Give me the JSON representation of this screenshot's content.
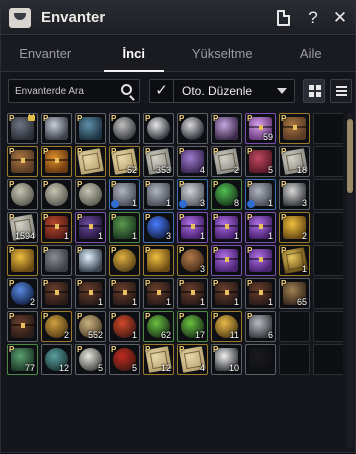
{
  "window": {
    "title": "Envanter",
    "icon": "storage-icon",
    "buttons": [
      {
        "name": "memo-icon",
        "glyph": ""
      },
      {
        "name": "help-icon",
        "glyph": "?"
      },
      {
        "name": "close-icon",
        "glyph": "✕"
      }
    ]
  },
  "tabs": [
    {
      "label": "Envanter",
      "active": false
    },
    {
      "label": "İnci",
      "active": true
    },
    {
      "label": "Yükseltme",
      "active": false
    },
    {
      "label": "Aile",
      "active": false
    }
  ],
  "toolbar": {
    "search_placeholder": "Envanterde Ara",
    "auto_sort_checked": true,
    "sort_label": "Oto. Düzenle"
  },
  "colors": {
    "accent_gold": "#9c7c2a",
    "rarity_purple": "#7b4fb3",
    "rarity_blue": "#3c6fb5",
    "rarity_green": "#4c8a46",
    "background": "#14161b"
  },
  "slots": [
    {
      "kind": "skin-dark",
      "p": true,
      "locked": true,
      "qty": "",
      "rarity": "gray"
    },
    {
      "kind": "wing-silver",
      "p": true,
      "qty": "",
      "rarity": "gray"
    },
    {
      "kind": "armor-blue",
      "p": true,
      "qty": "",
      "rarity": "gray"
    },
    {
      "kind": "flower-gray",
      "p": true,
      "qty": "",
      "rarity": "gray"
    },
    {
      "kind": "star-moon",
      "p": true,
      "qty": "",
      "rarity": "gray"
    },
    {
      "kind": "crescent",
      "p": true,
      "qty": "",
      "rarity": "gray"
    },
    {
      "kind": "pearl-box",
      "p": true,
      "qty": "",
      "rarity": "gray"
    },
    {
      "kind": "gift-box",
      "p": true,
      "qty": "59",
      "rarity": "purple"
    },
    {
      "kind": "chest-brown",
      "p": true,
      "qty": "",
      "rarity": "gold"
    },
    {
      "kind": "empty",
      "p": false,
      "qty": "",
      "rarity": ""
    },
    {
      "kind": "chest-brown",
      "p": true,
      "qty": "",
      "rarity": "gold"
    },
    {
      "kind": "chest-orange",
      "p": true,
      "qty": "",
      "rarity": "gold"
    },
    {
      "kind": "scroll-tan",
      "p": true,
      "qty": "",
      "rarity": "gold"
    },
    {
      "kind": "scroll-tan",
      "p": true,
      "qty": "52",
      "rarity": "gold"
    },
    {
      "kind": "scroll-gray",
      "p": true,
      "qty": "353",
      "rarity": "gray"
    },
    {
      "kind": "potion-purple",
      "p": true,
      "qty": "4",
      "rarity": "gray"
    },
    {
      "kind": "scroll-gray",
      "p": true,
      "qty": "2",
      "rarity": "gray"
    },
    {
      "kind": "book-red",
      "p": true,
      "qty": "5",
      "rarity": "gray"
    },
    {
      "kind": "scroll-gray",
      "p": true,
      "qty": "18",
      "rarity": "gray"
    },
    {
      "kind": "empty",
      "p": false,
      "qty": "",
      "rarity": ""
    },
    {
      "kind": "helm-gray",
      "p": true,
      "qty": "",
      "rarity": "gray"
    },
    {
      "kind": "helm-gray",
      "p": true,
      "qty": "",
      "rarity": "gray"
    },
    {
      "kind": "helm-gray",
      "p": true,
      "qty": "",
      "rarity": "gray"
    },
    {
      "kind": "stone-gray",
      "p": true,
      "qty": "1",
      "enh": true,
      "rarity": "blue"
    },
    {
      "kind": "stone-gray",
      "p": true,
      "qty": "1",
      "rarity": "gray"
    },
    {
      "kind": "horn-gray",
      "p": true,
      "qty": "3",
      "enh": true,
      "rarity": "blue"
    },
    {
      "kind": "orb-green",
      "p": true,
      "qty": "8",
      "rarity": "green"
    },
    {
      "kind": "stone-gray",
      "p": true,
      "qty": "1",
      "enh": true,
      "rarity": "blue"
    },
    {
      "kind": "tree-silver",
      "p": true,
      "qty": "3",
      "rarity": "gray"
    },
    {
      "kind": "empty",
      "p": false,
      "qty": "",
      "rarity": ""
    },
    {
      "kind": "scroll-gray",
      "p": true,
      "qty": "1594",
      "rarity": "gray"
    },
    {
      "kind": "chest-red",
      "p": true,
      "qty": "1",
      "rarity": "gold"
    },
    {
      "kind": "box-purple",
      "p": true,
      "qty": "1",
      "rarity": "purple"
    },
    {
      "kind": "book-green",
      "p": true,
      "qty": "1",
      "rarity": "green"
    },
    {
      "kind": "orb-blue",
      "p": true,
      "qty": "3",
      "rarity": "blue"
    },
    {
      "kind": "chest-purple",
      "p": true,
      "qty": "1",
      "rarity": "purple"
    },
    {
      "kind": "chest-purple",
      "p": true,
      "qty": "1",
      "rarity": "purple"
    },
    {
      "kind": "chest-purple",
      "p": true,
      "qty": "1",
      "rarity": "purple"
    },
    {
      "kind": "horn-gold",
      "p": true,
      "qty": "2",
      "rarity": "gold"
    },
    {
      "kind": "empty",
      "p": false,
      "qty": "",
      "rarity": ""
    },
    {
      "kind": "horn-gold",
      "p": true,
      "qty": "",
      "rarity": "gold"
    },
    {
      "kind": "pattern-gray",
      "p": true,
      "qty": "",
      "rarity": "gray"
    },
    {
      "kind": "crystal-white",
      "p": true,
      "qty": "",
      "rarity": "gray"
    },
    {
      "kind": "ring-gold",
      "p": true,
      "qty": "",
      "rarity": "gold"
    },
    {
      "kind": "horn-gold",
      "p": true,
      "qty": "",
      "rarity": "gold"
    },
    {
      "kind": "cookie-brown",
      "p": true,
      "qty": "3",
      "rarity": "gold"
    },
    {
      "kind": "chest-purple",
      "p": true,
      "qty": "",
      "rarity": "purple"
    },
    {
      "kind": "chest-purple",
      "p": true,
      "qty": "",
      "rarity": "purple"
    },
    {
      "kind": "ticket-gold",
      "p": true,
      "qty": "1",
      "rarity": "gold"
    },
    {
      "kind": "empty",
      "p": false,
      "qty": "",
      "rarity": ""
    },
    {
      "kind": "potion-blue",
      "p": true,
      "qty": "2",
      "rarity": "gray"
    },
    {
      "kind": "chest-dark",
      "p": true,
      "qty": "",
      "rarity": "gray"
    },
    {
      "kind": "chest-dark",
      "p": true,
      "qty": "1",
      "rarity": "gray"
    },
    {
      "kind": "chest-dark",
      "p": true,
      "qty": "1",
      "rarity": "gray"
    },
    {
      "kind": "chest-dark",
      "p": true,
      "qty": "1",
      "rarity": "gray"
    },
    {
      "kind": "chest-dark",
      "p": true,
      "qty": "1",
      "rarity": "gray"
    },
    {
      "kind": "chest-dark",
      "p": true,
      "qty": "1",
      "rarity": "gray"
    },
    {
      "kind": "chest-dark",
      "p": true,
      "qty": "1",
      "rarity": "gray"
    },
    {
      "kind": "vase-brown",
      "p": true,
      "qty": "65",
      "rarity": "gray"
    },
    {
      "kind": "empty",
      "p": false,
      "qty": "",
      "rarity": ""
    },
    {
      "kind": "chest-dark",
      "p": true,
      "qty": "",
      "rarity": "gray"
    },
    {
      "kind": "mirror-gold",
      "p": true,
      "qty": "2",
      "rarity": "gold"
    },
    {
      "kind": "pot-tan",
      "p": true,
      "qty": "552",
      "rarity": "gray"
    },
    {
      "kind": "flask-red",
      "p": true,
      "qty": "1",
      "rarity": "gray"
    },
    {
      "kind": "flask-green",
      "p": true,
      "qty": "62",
      "rarity": "green"
    },
    {
      "kind": "flask-green",
      "p": true,
      "qty": "17",
      "rarity": "green"
    },
    {
      "kind": "medal-gold",
      "p": true,
      "qty": "11",
      "rarity": "gold"
    },
    {
      "kind": "feather-gray",
      "p": true,
      "qty": "6",
      "rarity": "gray"
    },
    {
      "kind": "empty",
      "p": false,
      "qty": "",
      "rarity": ""
    },
    {
      "kind": "empty",
      "p": false,
      "qty": "",
      "rarity": ""
    },
    {
      "kind": "vase-green",
      "p": true,
      "qty": "77",
      "rarity": "green"
    },
    {
      "kind": "jar-teal",
      "p": false,
      "qty": "12",
      "rarity": "gray"
    },
    {
      "kind": "bowl-white",
      "p": true,
      "qty": "5",
      "rarity": "gray"
    },
    {
      "kind": "bowl-red",
      "p": true,
      "qty": "5",
      "rarity": "gray"
    },
    {
      "kind": "scroll-tan",
      "p": true,
      "qty": "12",
      "rarity": "gold"
    },
    {
      "kind": "scroll-tan",
      "p": true,
      "qty": "4",
      "rarity": "gold"
    },
    {
      "kind": "pet-white",
      "p": true,
      "qty": "10",
      "rarity": "gray"
    },
    {
      "kind": "slot-dark",
      "p": false,
      "qty": "",
      "rarity": "gray"
    },
    {
      "kind": "empty",
      "p": false,
      "qty": "",
      "rarity": ""
    },
    {
      "kind": "empty",
      "p": false,
      "qty": "",
      "rarity": ""
    }
  ],
  "scroll_position": 0.0
}
